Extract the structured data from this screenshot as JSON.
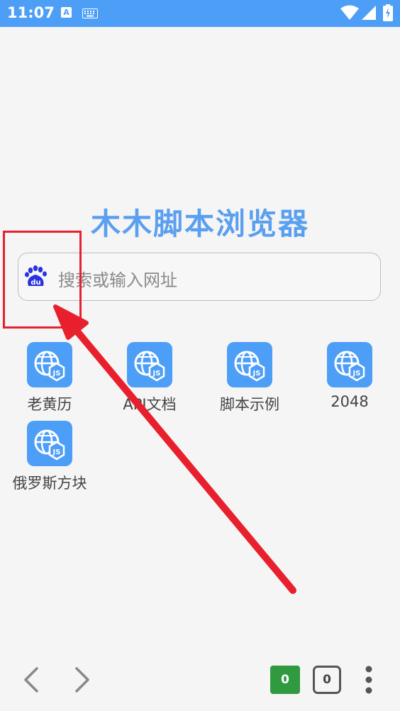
{
  "status_bar": {
    "time": "11:07",
    "notification_icon_letter": "A",
    "icons": [
      "keyboard-icon",
      "wifi-icon",
      "signal-icon",
      "battery-icon"
    ],
    "background_color": "#4d9ef7"
  },
  "title": "木木脚本浏览器",
  "search": {
    "placeholder": "搜索或输入网址",
    "engine_icon": "baidu-icon"
  },
  "shortcuts": [
    {
      "label": "老黄历",
      "icon": "globe-js-icon"
    },
    {
      "label": "API文档",
      "icon": "globe-js-icon"
    },
    {
      "label": "脚本示例",
      "icon": "globe-js-icon"
    },
    {
      "label": "2048",
      "icon": "globe-js-icon"
    },
    {
      "label": "俄罗斯方块",
      "icon": "globe-js-icon"
    }
  ],
  "toolbar": {
    "back_icon": "chevron-left-icon",
    "forward_icon": "chevron-right-icon",
    "counter_green": "0",
    "tab_count": "0",
    "menu_icon": "more-vertical-icon"
  },
  "colors": {
    "accent": "#4d9ef7",
    "title": "#5a9ff0",
    "annotation": "#e8202e",
    "counter_green": "#2f9a3f"
  }
}
